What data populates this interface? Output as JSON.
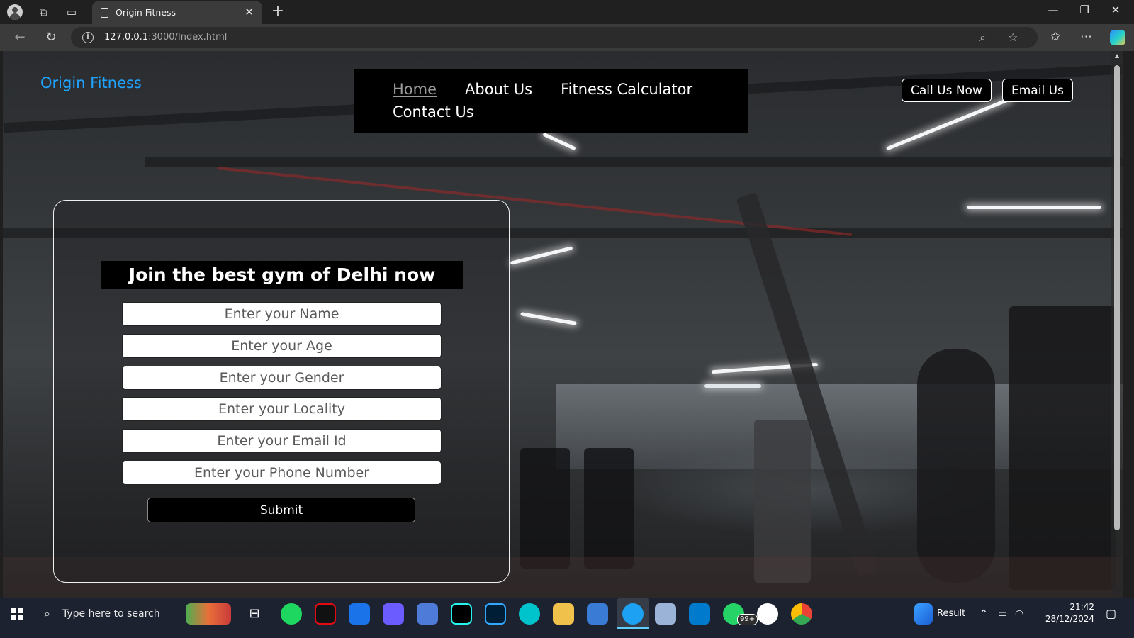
{
  "browser": {
    "tab_title": "Origin Fitness",
    "tab_close": "✕",
    "new_tab": "+",
    "url_host": "127.0.0.1",
    "url_path": ":3000/Index.html",
    "window_controls": [
      "—",
      "❐",
      "✕"
    ]
  },
  "site": {
    "brand": "Origin Fitness",
    "nav": [
      {
        "label": "Home",
        "active": true
      },
      {
        "label": "About Us"
      },
      {
        "label": "Fitness Calculator"
      },
      {
        "label": "Contact Us"
      }
    ],
    "actions": {
      "call": "Call Us Now",
      "email": "Email Us"
    }
  },
  "form": {
    "title": "Join the best gym of Delhi now",
    "fields": {
      "name": "Enter your Name",
      "age": "Enter your Age",
      "gender": "Enter your Gender",
      "locality": "Enter your Locality",
      "email": "Enter your Email Id",
      "phone": "Enter your Phone Number"
    },
    "submit": "Submit"
  },
  "taskbar": {
    "search_placeholder": "Type here to search",
    "whatsapp_badge": "99+",
    "weather_label": "Result",
    "time": "21:42",
    "date": "28/12/2024"
  },
  "colors": {
    "brand_text": "#1ea3ff",
    "nav_bg": "#000000",
    "taskbar_bg": "#1c2230"
  }
}
